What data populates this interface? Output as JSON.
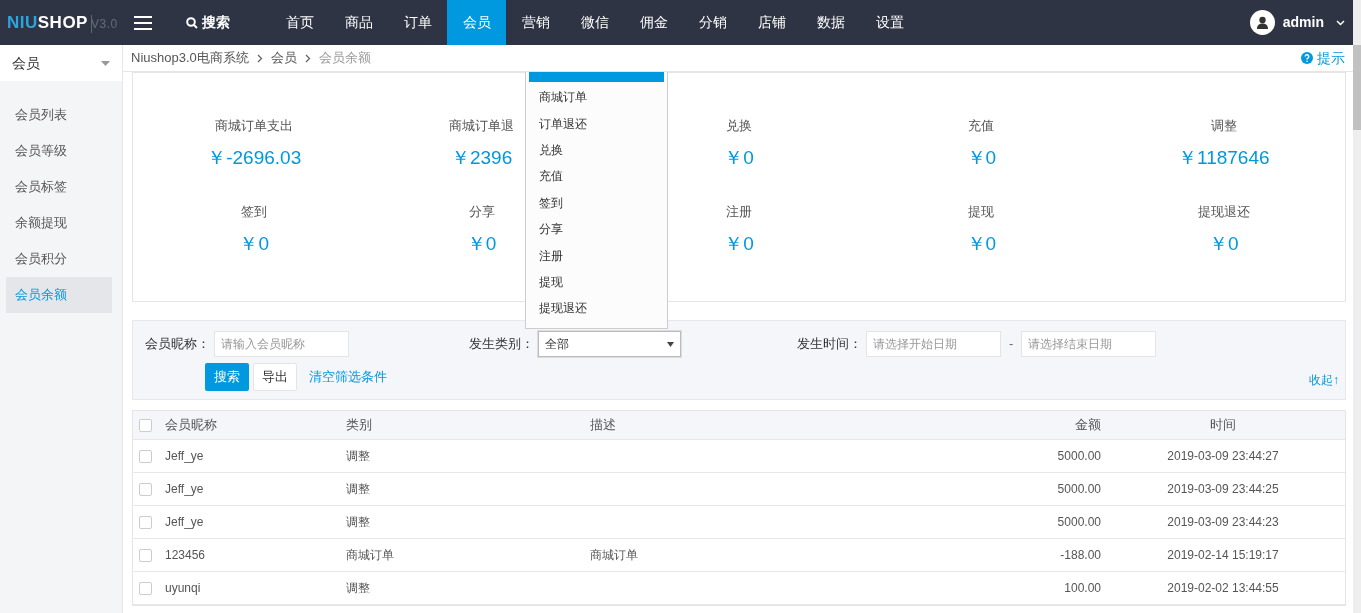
{
  "topbar": {
    "logo": {
      "accent": "NIU",
      "main": "SHOP",
      "version": "V3.0"
    },
    "search": "搜索",
    "nav": [
      {
        "label": "首页",
        "selected": false
      },
      {
        "label": "商品",
        "selected": false
      },
      {
        "label": "订单",
        "selected": false
      },
      {
        "label": "会员",
        "selected": true
      },
      {
        "label": "营销",
        "selected": false
      },
      {
        "label": "微信",
        "selected": false
      },
      {
        "label": "佣金",
        "selected": false
      },
      {
        "label": "分销",
        "selected": false
      },
      {
        "label": "店铺",
        "selected": false
      },
      {
        "label": "数据",
        "selected": false
      },
      {
        "label": "设置",
        "selected": false
      }
    ],
    "user": "admin"
  },
  "sidebar": {
    "title": "会员",
    "items": [
      {
        "label": "会员列表",
        "selected": false
      },
      {
        "label": "会员等级",
        "selected": false
      },
      {
        "label": "会员标签",
        "selected": false
      },
      {
        "label": "余额提现",
        "selected": false
      },
      {
        "label": "会员积分",
        "selected": false
      },
      {
        "label": "会员余额",
        "selected": true
      }
    ]
  },
  "breadcrumb": [
    "Niushop3.0电商系统",
    "会员",
    "会员余额"
  ],
  "hint": "提示",
  "stats": [
    {
      "label": "商城订单支出",
      "value": "￥-2696.03"
    },
    {
      "label": "商城订单退",
      "value": "￥2396"
    },
    {
      "label": "兑换",
      "value": "￥0"
    },
    {
      "label": "充值",
      "value": "￥0"
    },
    {
      "label": "调整",
      "value": "￥1187646"
    },
    {
      "label": "签到",
      "value": "￥0"
    },
    {
      "label": "分享",
      "value": "￥0"
    },
    {
      "label": "注册",
      "value": "￥0"
    },
    {
      "label": "提现",
      "value": "￥0"
    },
    {
      "label": "提现退还",
      "value": "￥0"
    }
  ],
  "filters": {
    "nickname": {
      "label": "会员昵称：",
      "placeholder": "请输入会员昵称"
    },
    "type": {
      "label": "发生类别：",
      "value": "全部",
      "expanded": true,
      "options": [
        {
          "selected": true
        },
        {
          "label": "商城订单",
          "selected": false
        },
        {
          "label": "订单退还",
          "selected": false
        },
        {
          "label": "兑换",
          "selected": false
        },
        {
          "label": "充值",
          "selected": false
        },
        {
          "label": "签到",
          "selected": false
        },
        {
          "label": "分享",
          "selected": false
        },
        {
          "label": "注册",
          "selected": false
        },
        {
          "label": "提现",
          "selected": false
        },
        {
          "label": "提现退还",
          "selected": false
        }
      ]
    },
    "time": {
      "label": "发生时间：",
      "start_placeholder": "请选择开始日期",
      "separator": "-",
      "end_placeholder": "请选择结束日期"
    },
    "buttons": {
      "search": "搜索",
      "export": "导出",
      "clear": "清空筛选条件"
    },
    "collapse": "收起↑"
  },
  "table": {
    "all_checked": false,
    "columns": [
      "会员昵称",
      "类别",
      "描述",
      "金额",
      "时间"
    ],
    "rows": [
      {
        "checked": false,
        "cells": [
          "Jeff_ye",
          "调整",
          "",
          "5000.00",
          "2019-03-09 23:44:27"
        ]
      },
      {
        "checked": false,
        "cells": [
          "Jeff_ye",
          "调整",
          "",
          "5000.00",
          "2019-03-09 23:44:25"
        ]
      },
      {
        "checked": false,
        "cells": [
          "Jeff_ye",
          "调整",
          "",
          "5000.00",
          "2019-03-09 23:44:23"
        ]
      },
      {
        "checked": false,
        "cells": [
          "123456",
          "商城订单",
          "商城订单",
          "-188.00",
          "2019-02-14 15:19:17"
        ]
      },
      {
        "checked": false,
        "cells": [
          "uyunqi",
          "调整",
          "",
          "100.00",
          "2019-02-02 13:44:55"
        ]
      }
    ]
  }
}
